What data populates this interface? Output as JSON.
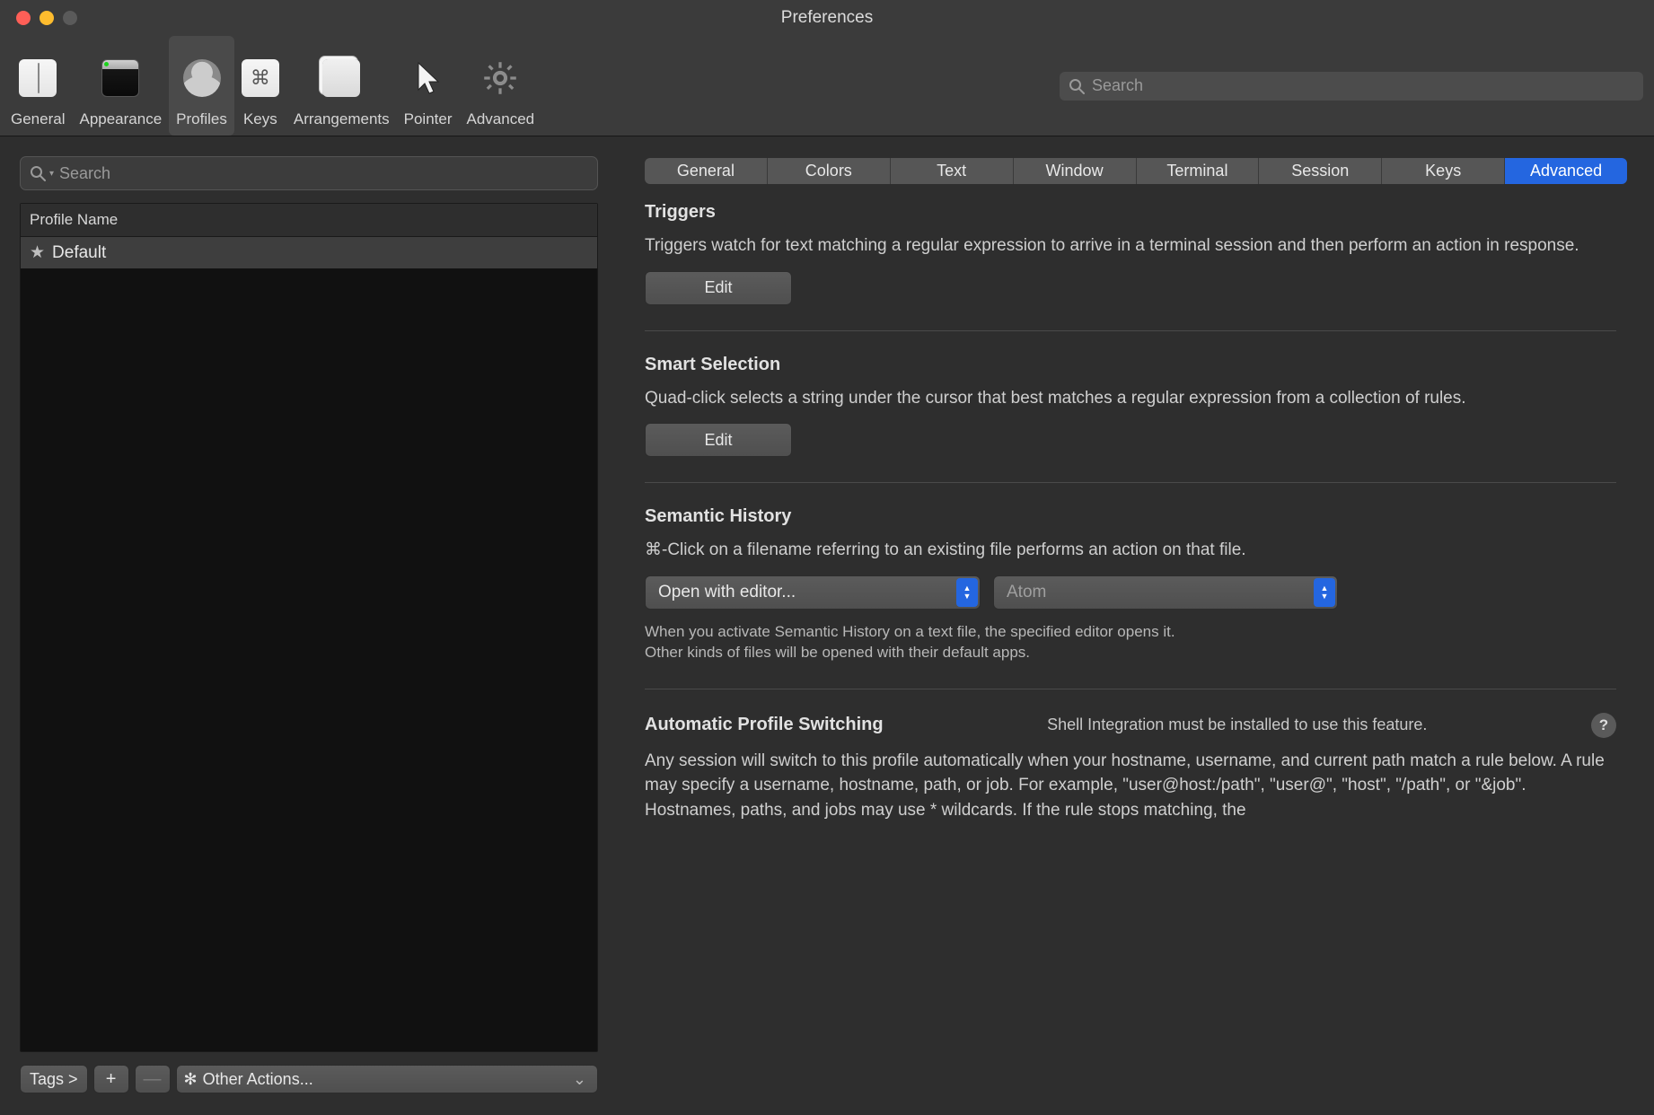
{
  "window": {
    "title": "Preferences"
  },
  "toolbar": {
    "items": [
      {
        "label": "General"
      },
      {
        "label": "Appearance"
      },
      {
        "label": "Profiles"
      },
      {
        "label": "Keys"
      },
      {
        "label": "Arrangements"
      },
      {
        "label": "Pointer"
      },
      {
        "label": "Advanced"
      }
    ],
    "search_placeholder": "Search"
  },
  "sidebar": {
    "search_placeholder": "Search",
    "header": "Profile Name",
    "profiles": [
      {
        "name": "Default",
        "starred": true
      }
    ],
    "footer": {
      "tags": "Tags >",
      "add": "+",
      "remove": "—",
      "other_actions": "Other Actions..."
    }
  },
  "tabs": [
    "General",
    "Colors",
    "Text",
    "Window",
    "Terminal",
    "Session",
    "Keys",
    "Advanced"
  ],
  "active_tab": "Advanced",
  "sections": {
    "triggers": {
      "title": "Triggers",
      "desc": "Triggers watch for text matching a regular expression to arrive in a terminal session and then perform an action in response.",
      "edit": "Edit"
    },
    "smart_selection": {
      "title": "Smart Selection",
      "desc": "Quad-click selects a string under the cursor that best matches a regular expression from a collection of rules.",
      "edit": "Edit"
    },
    "semantic_history": {
      "title": "Semantic History",
      "desc": "⌘-Click on a filename referring to an existing file performs an action on that file.",
      "action": "Open with editor...",
      "editor": "Atom",
      "note1": "When you activate Semantic History on a text file, the specified editor opens it.",
      "note2": "Other kinds of files will be opened with their default apps."
    },
    "aps": {
      "title": "Automatic Profile Switching",
      "note": "Shell Integration must be installed to use this feature.",
      "help": "?",
      "desc": "Any session will switch to this profile automatically when your hostname, username, and current path match a rule below. A rule may specify a username, hostname, path, or job. For example, \"user@host:/path\", \"user@\", \"host\", \"/path\", or \"&job\". Hostnames, paths, and jobs may use * wildcards. If the rule stops matching, the"
    }
  }
}
